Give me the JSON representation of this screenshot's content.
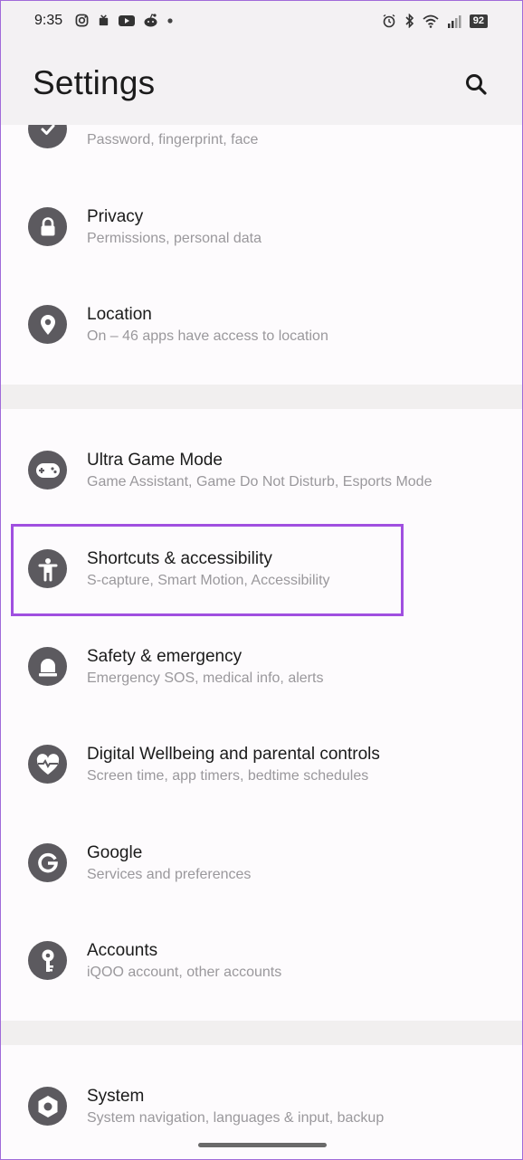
{
  "status_bar": {
    "time": "9:35",
    "battery": "92",
    "left_icons": [
      "instagram-icon",
      "notification-icon",
      "youtube-icon",
      "reddit-icon",
      "dot-icon"
    ],
    "right_icons": [
      "alarm-icon",
      "bluetooth-icon",
      "wifi-icon",
      "signal-icon",
      "battery-icon"
    ]
  },
  "header": {
    "title": "Settings"
  },
  "items": [
    {
      "label": "",
      "sub": "Password, fingerprint, face",
      "icon": "shield-check-icon"
    },
    {
      "label": "Privacy",
      "sub": "Permissions, personal data",
      "icon": "lock-icon"
    },
    {
      "label": "Location",
      "sub": "On – 46 apps have access to location",
      "icon": "location-pin-icon"
    },
    {
      "label": "Ultra Game Mode",
      "sub": "Game Assistant, Game Do Not Disturb, Esports Mode",
      "icon": "gamepad-icon"
    },
    {
      "label": "Shortcuts & accessibility",
      "sub": "S-capture, Smart Motion, Accessibility",
      "icon": "accessibility-icon"
    },
    {
      "label": "Safety & emergency",
      "sub": "Emergency SOS, medical info, alerts",
      "icon": "siren-icon"
    },
    {
      "label": "Digital Wellbeing and parental controls",
      "sub": "Screen time, app timers, bedtime schedules",
      "icon": "heart-icon"
    },
    {
      "label": "Google",
      "sub": "Services and preferences",
      "icon": "google-icon"
    },
    {
      "label": "Accounts",
      "sub": "iQOO account, other accounts",
      "icon": "key-icon"
    },
    {
      "label": "System",
      "sub": "System navigation, languages & input, backup",
      "icon": "hexagon-settings-icon"
    }
  ]
}
